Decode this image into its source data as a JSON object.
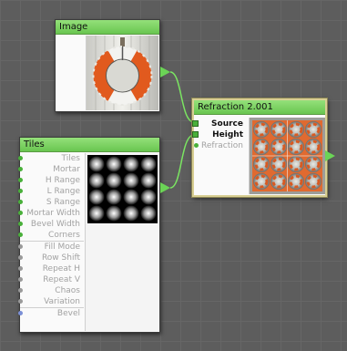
{
  "nodes": {
    "image": {
      "title": "Image"
    },
    "tiles": {
      "title": "Tiles",
      "inputs": [
        {
          "label": "Tiles",
          "port": "green"
        },
        {
          "label": "Mortar",
          "port": "green"
        },
        {
          "label": "H Range",
          "port": "green"
        },
        {
          "label": "L Range",
          "port": "green"
        },
        {
          "label": "S Range",
          "port": "green"
        },
        {
          "label": "Mortar Width",
          "port": "green"
        },
        {
          "label": "Bevel Width",
          "port": "green"
        },
        {
          "label": "Corners",
          "port": "green"
        },
        {
          "label": "Fill Mode",
          "port": "gray"
        },
        {
          "label": "Row Shift",
          "port": "gray"
        },
        {
          "label": "Repeat H",
          "port": "gray"
        },
        {
          "label": "Repeat V",
          "port": "gray"
        },
        {
          "label": "Chaos",
          "port": "gray"
        },
        {
          "label": "Variation",
          "port": "gray"
        },
        {
          "label": "Bevel",
          "port": "blue"
        }
      ]
    },
    "refraction": {
      "title": "Refraction 2.001",
      "inputs": [
        {
          "label": "Source",
          "port": "green",
          "state": "connected"
        },
        {
          "label": "Height",
          "port": "green",
          "state": "connected"
        },
        {
          "label": "Refraction",
          "port": "green",
          "state": "unconnected"
        }
      ]
    }
  },
  "colors": {
    "wire": "#7be562",
    "title_bar": "#7ed465",
    "selection": "#d8cf93"
  }
}
